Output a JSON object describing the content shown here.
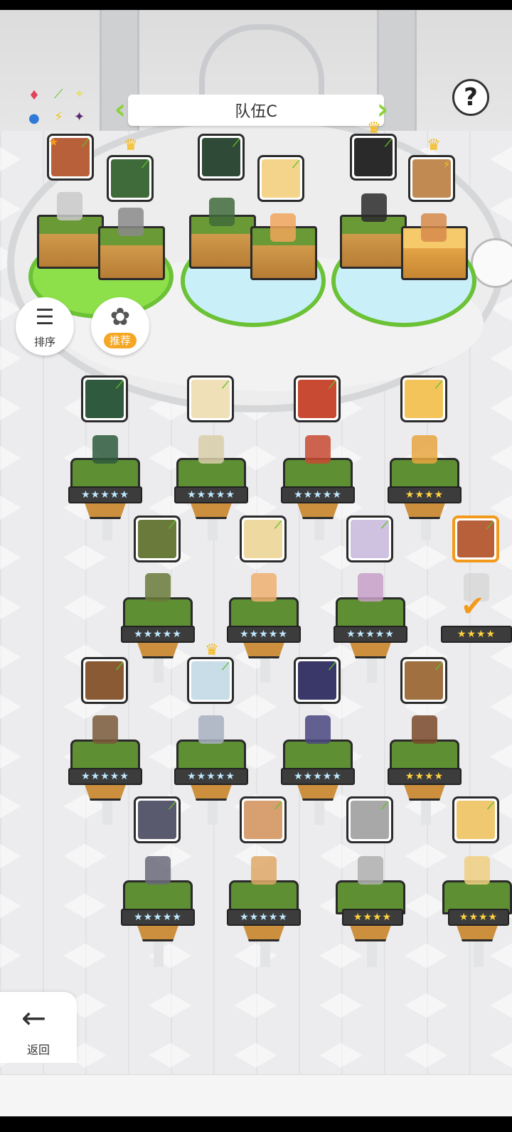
{
  "header": {
    "title": "队伍C",
    "help_label": "?"
  },
  "sort_button": {
    "label": "排序"
  },
  "recommend_button": {
    "label": "推荐"
  },
  "back_button": {
    "label": "返回"
  },
  "team": [
    {
      "slot": 1,
      "element_color": "#b8603a"
    },
    {
      "slot": 2,
      "element_color": "#3f6a3a"
    },
    {
      "slot": 3,
      "element_color": "#2f4a36"
    },
    {
      "slot": 4,
      "element_color": "#f4d48a"
    },
    {
      "slot": 5,
      "element_color": "#2a2a2a"
    },
    {
      "slot": 6,
      "element_color": "#c08a52"
    }
  ],
  "roster_stars": {
    "r1": [
      "★★★★★",
      "★★★★★",
      "★★★★★",
      "★★★★"
    ],
    "r2": [
      "★★★★★",
      "★★★★★",
      "★★★★★",
      "★★★★"
    ],
    "r3": [
      "★★★★★",
      "★★★★★",
      "★★★★★",
      "★★★★"
    ],
    "r4": [
      "★★★★★",
      "★★★★★",
      "★★★★",
      "★★★★"
    ]
  },
  "colors": {
    "accent": "#8bd33a",
    "highlight": "#f39a1c",
    "crown": "#f6b70f"
  }
}
